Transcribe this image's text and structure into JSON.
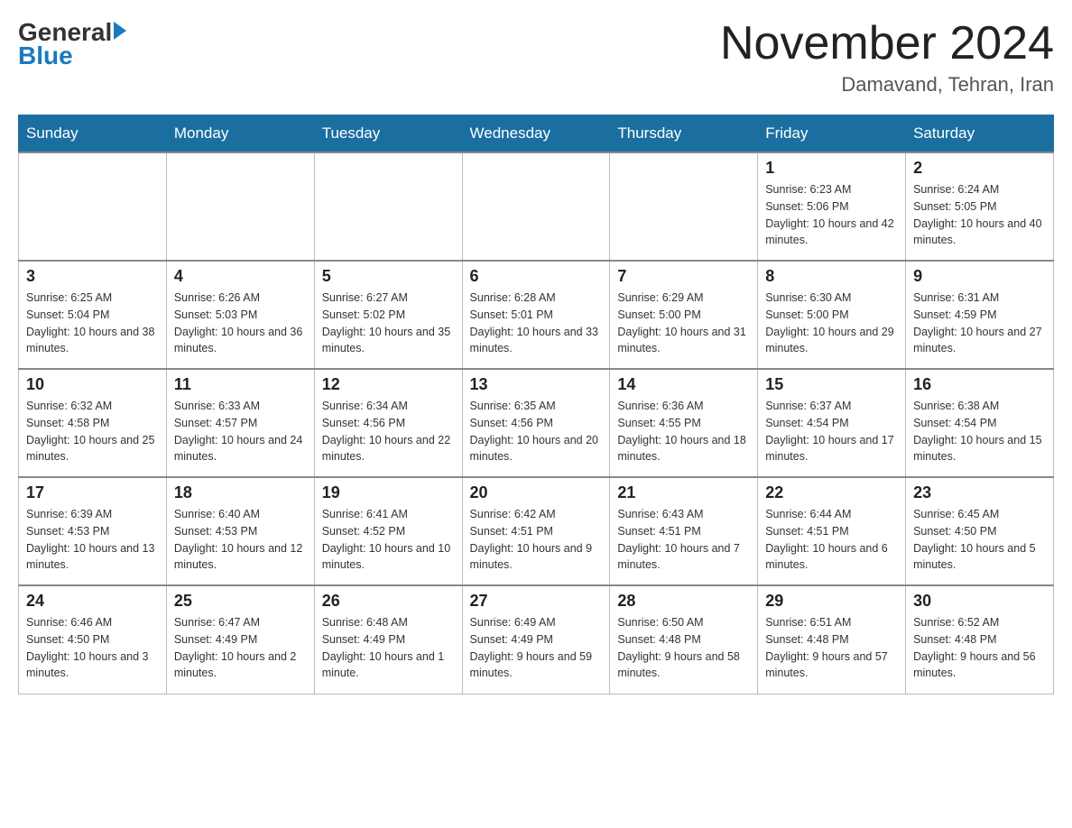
{
  "header": {
    "logo_general": "General",
    "logo_blue": "Blue",
    "month_title": "November 2024",
    "location": "Damavand, Tehran, Iran"
  },
  "weekdays": [
    "Sunday",
    "Monday",
    "Tuesday",
    "Wednesday",
    "Thursday",
    "Friday",
    "Saturday"
  ],
  "weeks": [
    [
      {
        "day": "",
        "sunrise": "",
        "sunset": "",
        "daylight": ""
      },
      {
        "day": "",
        "sunrise": "",
        "sunset": "",
        "daylight": ""
      },
      {
        "day": "",
        "sunrise": "",
        "sunset": "",
        "daylight": ""
      },
      {
        "day": "",
        "sunrise": "",
        "sunset": "",
        "daylight": ""
      },
      {
        "day": "",
        "sunrise": "",
        "sunset": "",
        "daylight": ""
      },
      {
        "day": "1",
        "sunrise": "Sunrise: 6:23 AM",
        "sunset": "Sunset: 5:06 PM",
        "daylight": "Daylight: 10 hours and 42 minutes."
      },
      {
        "day": "2",
        "sunrise": "Sunrise: 6:24 AM",
        "sunset": "Sunset: 5:05 PM",
        "daylight": "Daylight: 10 hours and 40 minutes."
      }
    ],
    [
      {
        "day": "3",
        "sunrise": "Sunrise: 6:25 AM",
        "sunset": "Sunset: 5:04 PM",
        "daylight": "Daylight: 10 hours and 38 minutes."
      },
      {
        "day": "4",
        "sunrise": "Sunrise: 6:26 AM",
        "sunset": "Sunset: 5:03 PM",
        "daylight": "Daylight: 10 hours and 36 minutes."
      },
      {
        "day": "5",
        "sunrise": "Sunrise: 6:27 AM",
        "sunset": "Sunset: 5:02 PM",
        "daylight": "Daylight: 10 hours and 35 minutes."
      },
      {
        "day": "6",
        "sunrise": "Sunrise: 6:28 AM",
        "sunset": "Sunset: 5:01 PM",
        "daylight": "Daylight: 10 hours and 33 minutes."
      },
      {
        "day": "7",
        "sunrise": "Sunrise: 6:29 AM",
        "sunset": "Sunset: 5:00 PM",
        "daylight": "Daylight: 10 hours and 31 minutes."
      },
      {
        "day": "8",
        "sunrise": "Sunrise: 6:30 AM",
        "sunset": "Sunset: 5:00 PM",
        "daylight": "Daylight: 10 hours and 29 minutes."
      },
      {
        "day": "9",
        "sunrise": "Sunrise: 6:31 AM",
        "sunset": "Sunset: 4:59 PM",
        "daylight": "Daylight: 10 hours and 27 minutes."
      }
    ],
    [
      {
        "day": "10",
        "sunrise": "Sunrise: 6:32 AM",
        "sunset": "Sunset: 4:58 PM",
        "daylight": "Daylight: 10 hours and 25 minutes."
      },
      {
        "day": "11",
        "sunrise": "Sunrise: 6:33 AM",
        "sunset": "Sunset: 4:57 PM",
        "daylight": "Daylight: 10 hours and 24 minutes."
      },
      {
        "day": "12",
        "sunrise": "Sunrise: 6:34 AM",
        "sunset": "Sunset: 4:56 PM",
        "daylight": "Daylight: 10 hours and 22 minutes."
      },
      {
        "day": "13",
        "sunrise": "Sunrise: 6:35 AM",
        "sunset": "Sunset: 4:56 PM",
        "daylight": "Daylight: 10 hours and 20 minutes."
      },
      {
        "day": "14",
        "sunrise": "Sunrise: 6:36 AM",
        "sunset": "Sunset: 4:55 PM",
        "daylight": "Daylight: 10 hours and 18 minutes."
      },
      {
        "day": "15",
        "sunrise": "Sunrise: 6:37 AM",
        "sunset": "Sunset: 4:54 PM",
        "daylight": "Daylight: 10 hours and 17 minutes."
      },
      {
        "day": "16",
        "sunrise": "Sunrise: 6:38 AM",
        "sunset": "Sunset: 4:54 PM",
        "daylight": "Daylight: 10 hours and 15 minutes."
      }
    ],
    [
      {
        "day": "17",
        "sunrise": "Sunrise: 6:39 AM",
        "sunset": "Sunset: 4:53 PM",
        "daylight": "Daylight: 10 hours and 13 minutes."
      },
      {
        "day": "18",
        "sunrise": "Sunrise: 6:40 AM",
        "sunset": "Sunset: 4:53 PM",
        "daylight": "Daylight: 10 hours and 12 minutes."
      },
      {
        "day": "19",
        "sunrise": "Sunrise: 6:41 AM",
        "sunset": "Sunset: 4:52 PM",
        "daylight": "Daylight: 10 hours and 10 minutes."
      },
      {
        "day": "20",
        "sunrise": "Sunrise: 6:42 AM",
        "sunset": "Sunset: 4:51 PM",
        "daylight": "Daylight: 10 hours and 9 minutes."
      },
      {
        "day": "21",
        "sunrise": "Sunrise: 6:43 AM",
        "sunset": "Sunset: 4:51 PM",
        "daylight": "Daylight: 10 hours and 7 minutes."
      },
      {
        "day": "22",
        "sunrise": "Sunrise: 6:44 AM",
        "sunset": "Sunset: 4:51 PM",
        "daylight": "Daylight: 10 hours and 6 minutes."
      },
      {
        "day": "23",
        "sunrise": "Sunrise: 6:45 AM",
        "sunset": "Sunset: 4:50 PM",
        "daylight": "Daylight: 10 hours and 5 minutes."
      }
    ],
    [
      {
        "day": "24",
        "sunrise": "Sunrise: 6:46 AM",
        "sunset": "Sunset: 4:50 PM",
        "daylight": "Daylight: 10 hours and 3 minutes."
      },
      {
        "day": "25",
        "sunrise": "Sunrise: 6:47 AM",
        "sunset": "Sunset: 4:49 PM",
        "daylight": "Daylight: 10 hours and 2 minutes."
      },
      {
        "day": "26",
        "sunrise": "Sunrise: 6:48 AM",
        "sunset": "Sunset: 4:49 PM",
        "daylight": "Daylight: 10 hours and 1 minute."
      },
      {
        "day": "27",
        "sunrise": "Sunrise: 6:49 AM",
        "sunset": "Sunset: 4:49 PM",
        "daylight": "Daylight: 9 hours and 59 minutes."
      },
      {
        "day": "28",
        "sunrise": "Sunrise: 6:50 AM",
        "sunset": "Sunset: 4:48 PM",
        "daylight": "Daylight: 9 hours and 58 minutes."
      },
      {
        "day": "29",
        "sunrise": "Sunrise: 6:51 AM",
        "sunset": "Sunset: 4:48 PM",
        "daylight": "Daylight: 9 hours and 57 minutes."
      },
      {
        "day": "30",
        "sunrise": "Sunrise: 6:52 AM",
        "sunset": "Sunset: 4:48 PM",
        "daylight": "Daylight: 9 hours and 56 minutes."
      }
    ]
  ]
}
